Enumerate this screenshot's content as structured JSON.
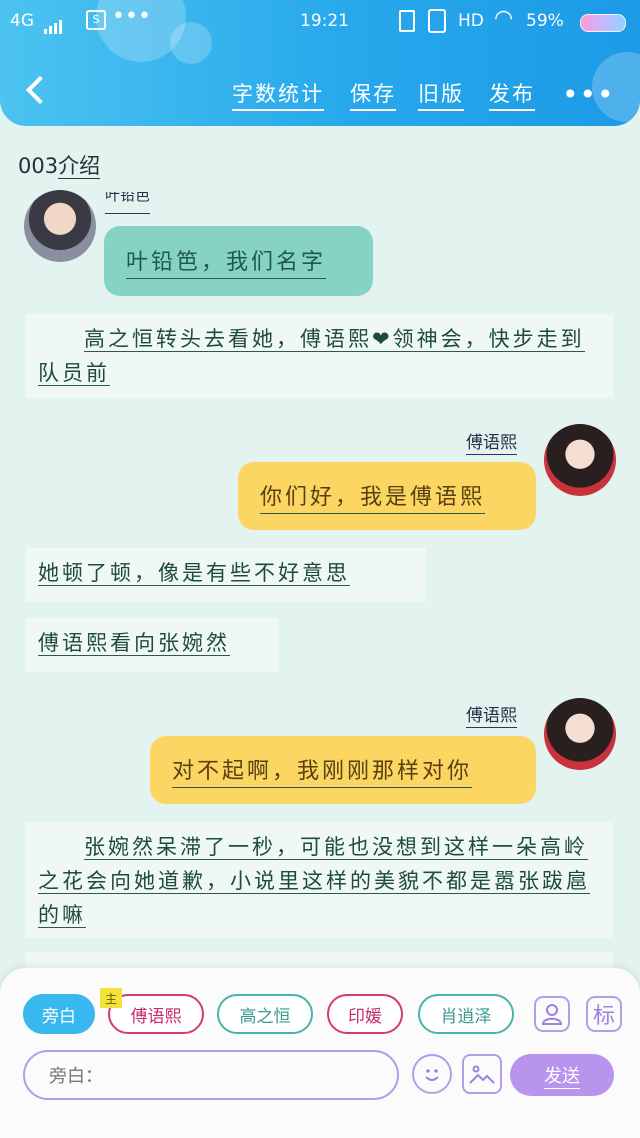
{
  "status_bar": {
    "network": "4G",
    "time": "19:21",
    "hd": "HD",
    "battery": "59%"
  },
  "toolbar": {
    "word_count": "字数统计",
    "save": "保存",
    "old_version": "旧版",
    "publish": "发布",
    "more": "•••"
  },
  "story": {
    "title_prefix": "003",
    "title_rest": "介绍"
  },
  "messages": {
    "m1": {
      "name": "叶铅笆",
      "text": "叶铅笆，我们名字"
    },
    "n1": {
      "text": "高之恒转头去看她，傅语熙❤领神会，快步走到队员前"
    },
    "m2": {
      "name": "傅语熙",
      "text": "你们好，我是傅语熙"
    },
    "n2": {
      "text": "她顿了顿，像是有些不好意思"
    },
    "n3": {
      "text": "傅语熙看向张婉然"
    },
    "m3": {
      "name": "傅语熙",
      "text": "对不起啊，我刚刚那样对你"
    },
    "n4": {
      "text": "张婉然呆滞了一秒，可能也没想到这样一朵高岭之花会向她道歉，小说里这样的美貌不都是嚣张跋扈的嘛"
    }
  },
  "composer": {
    "chips": [
      "旁白",
      "傅语熙",
      "高之恒",
      "印媛",
      "肖逍泽"
    ],
    "chip_tag": "主",
    "person_icon": "person-icon",
    "tag_button": "标",
    "input_placeholder": "旁白：",
    "emoji_icon": "emoji-icon",
    "image_icon": "image-icon",
    "send": "发送"
  }
}
